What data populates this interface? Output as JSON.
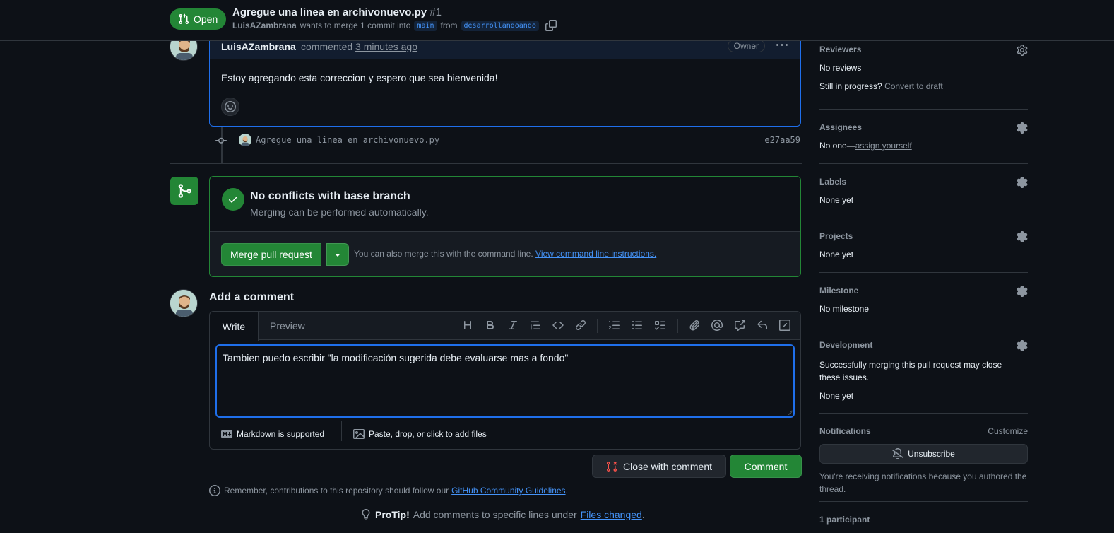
{
  "header": {
    "state_label": "Open",
    "title": "Agregue una linea en archivonuevo.py",
    "number": "#1",
    "author": "LuisAZambrana",
    "merge_text": "wants to merge 1 commit into",
    "base_branch": "main",
    "from_text": "from",
    "head_branch": "desarrollandoando"
  },
  "comment": {
    "author": "LuisAZambrana",
    "action": "commented",
    "time": "3 minutes ago",
    "role_badge": "Owner",
    "body": "Estoy agregando esta correccion y espero que sea bienvenida!"
  },
  "commit": {
    "message": "Agregue una linea en archivonuevo.py",
    "sha": "e27aa59"
  },
  "merge": {
    "title": "No conflicts with base branch",
    "subtitle": "Merging can be performed automatically.",
    "button_label": "Merge pull request",
    "note_text": "You can also merge this with the command line.",
    "note_link": "View command line instructions."
  },
  "add_comment": {
    "heading": "Add a comment",
    "tab_write": "Write",
    "tab_preview": "Preview",
    "textarea_value": "Tambien puedo escribir \"la modificación sugerida debe evaluarse mas a fondo\"",
    "markdown_note": "Markdown is supported",
    "files_note": "Paste, drop, or click to add files",
    "close_button": "Close with comment",
    "comment_button": "Comment",
    "guidelines_text": "Remember, contributions to this repository should follow our",
    "guidelines_link": "GitHub Community Guidelines",
    "guidelines_end": ".",
    "protip_label": "ProTip!",
    "protip_text": "Add comments to specific lines under",
    "protip_link": "Files changed",
    "protip_end": "."
  },
  "sidebar": {
    "reviewers": {
      "heading": "Reviewers",
      "value": "No reviews",
      "progress_text": "Still in progress?",
      "progress_link": "Convert to draft"
    },
    "assignees": {
      "heading": "Assignees",
      "value": "No one—",
      "link": "assign yourself"
    },
    "labels": {
      "heading": "Labels",
      "value": "None yet"
    },
    "projects": {
      "heading": "Projects",
      "value": "None yet"
    },
    "milestone": {
      "heading": "Milestone",
      "value": "No milestone"
    },
    "development": {
      "heading": "Development",
      "text": "Successfully merging this pull request may close these issues.",
      "value": "None yet"
    },
    "notifications": {
      "heading": "Notifications",
      "customize": "Customize",
      "button": "Unsubscribe",
      "text": "You're receiving notifications because you authored the thread."
    },
    "participants": {
      "heading": "1 participant"
    }
  },
  "colors": {
    "background": "#0d1117",
    "accent_green": "#238636",
    "accent_blue": "#1f6feb",
    "link": "#4493f8",
    "muted": "#8d96a0"
  },
  "icons": [
    "git-pull-request-icon",
    "copy-icon",
    "kebab-icon",
    "smiley-icon",
    "git-commit-icon",
    "git-merge-icon",
    "check-icon",
    "triangle-down-icon",
    "heading-icon",
    "bold-icon",
    "italic-icon",
    "quote-icon",
    "code-icon",
    "link-icon",
    "numbered-list-icon",
    "unordered-list-icon",
    "tasklist-icon",
    "paperclip-icon",
    "mention-icon",
    "cross-reference-icon",
    "reply-icon",
    "slash-icon",
    "markdown-icon",
    "image-icon",
    "git-pull-request-closed-icon",
    "info-icon",
    "light-bulb-icon",
    "gear-icon",
    "bell-slash-icon"
  ]
}
